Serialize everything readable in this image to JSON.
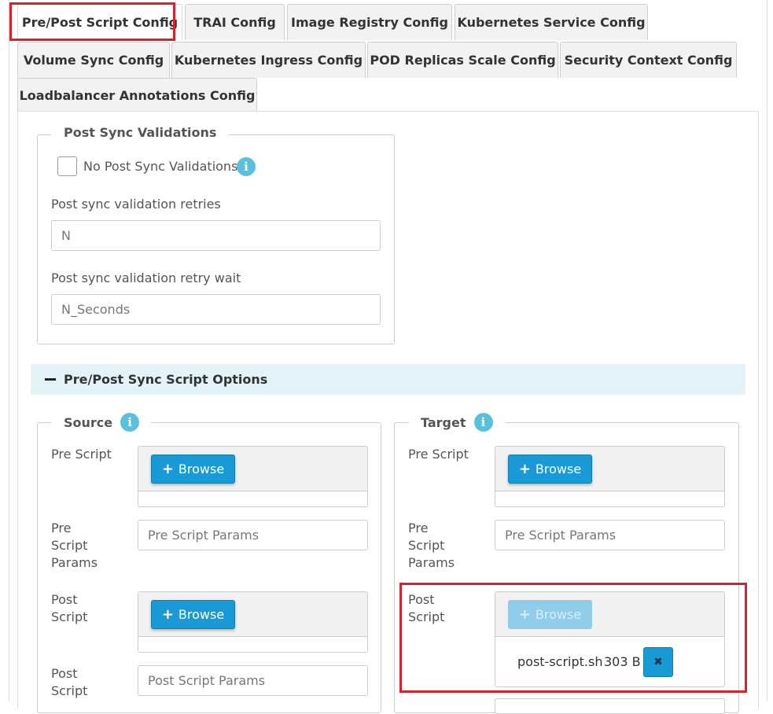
{
  "tabs": [
    {
      "label": "Pre/Post Script Config",
      "active": true
    },
    {
      "label": "TRAI Config"
    },
    {
      "label": "Image Registry Config"
    },
    {
      "label": "Kubernetes Service Config"
    },
    {
      "label": "Volume Sync Config"
    },
    {
      "label": "Kubernetes Ingress Config"
    },
    {
      "label": "POD Replicas Scale Config"
    },
    {
      "label": "Security Context Config"
    },
    {
      "label": "Loadbalancer Annotations Config"
    }
  ],
  "post_sync": {
    "legend": "Post Sync Validations",
    "no_validation_label": "No Post Sync Validations",
    "retries_label": "Post sync validation retries",
    "retries_placeholder": "N",
    "retry_wait_label": "Post sync validation retry wait",
    "retry_wait_placeholder": "N_Seconds"
  },
  "script_options_header": "Pre/Post Sync Script Options",
  "source": {
    "legend": "Source",
    "pre_script_label": "Pre Script",
    "pre_script_params_label": "Pre Script Params",
    "pre_script_params_placeholder": "Pre Script Params",
    "post_script_label": "Post Script",
    "post_script_params_label": "Post Script",
    "post_script_params_placeholder": "Post Script Params",
    "browse_label": "Browse"
  },
  "target": {
    "legend": "Target",
    "pre_script_label": "Pre Script",
    "pre_script_params_label": "Pre Script Params",
    "pre_script_params_placeholder": "Pre Script Params",
    "post_script_label": "Post Script",
    "browse_label": "Browse",
    "uploaded_file": {
      "name": "post-script.sh",
      "size": "303 B"
    }
  },
  "colors": {
    "primary": "#199ad6",
    "info": "#5bc0de",
    "highlight": "#d9202f",
    "section_bg": "#e4f3f8"
  },
  "icons": {
    "info": "info-circle-icon",
    "plus": "plus-icon",
    "remove": "times-icon",
    "collapse": "minus-icon"
  }
}
